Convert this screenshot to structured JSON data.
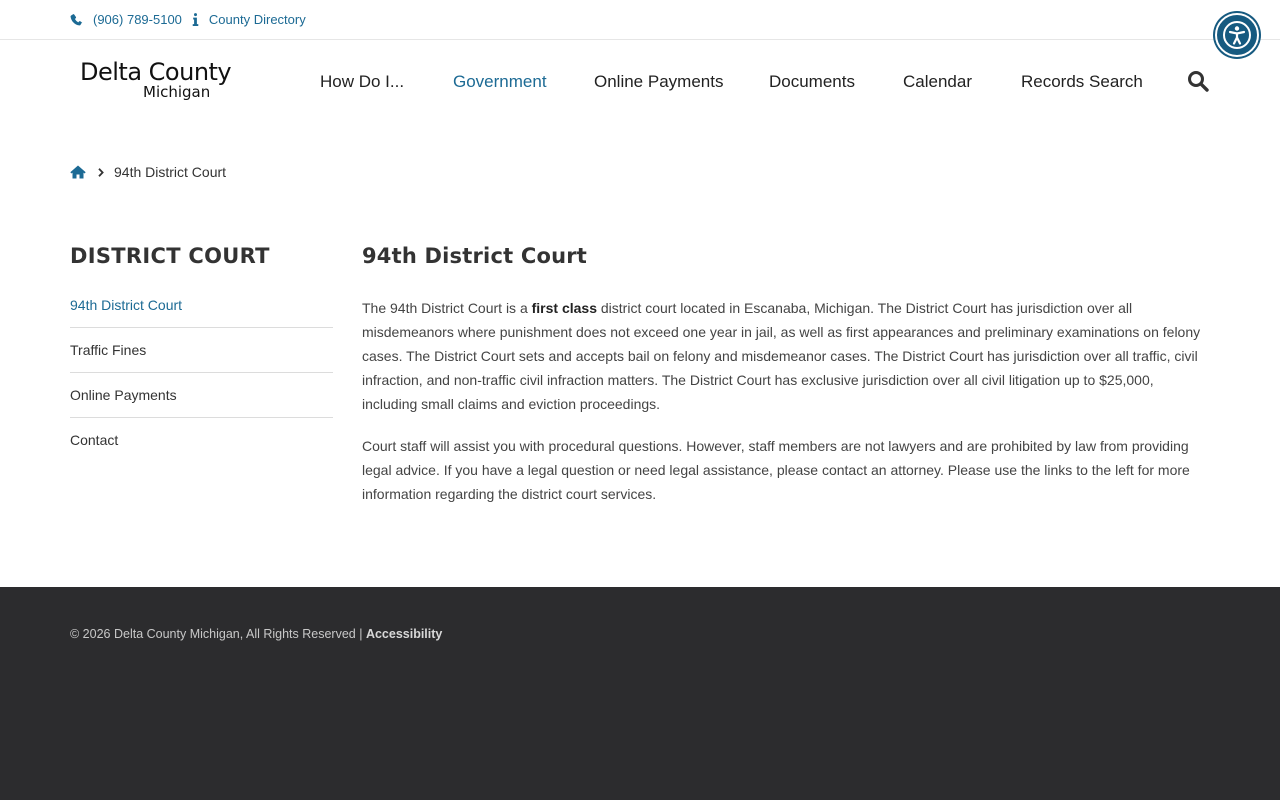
{
  "topbar": {
    "phone": "(906) 789-5100",
    "directory": "County Directory"
  },
  "logo": {
    "line1": "Delta County",
    "line2": "Michigan"
  },
  "nav": {
    "items": [
      {
        "label": "How Do I..."
      },
      {
        "label": "Government"
      },
      {
        "label": "Online Payments"
      },
      {
        "label": "Documents"
      },
      {
        "label": "Calendar"
      },
      {
        "label": "Records Search"
      }
    ]
  },
  "breadcrumb": {
    "current": "94th District Court"
  },
  "sidebar": {
    "title": "DISTRICT COURT",
    "items": [
      {
        "label": "94th District Court"
      },
      {
        "label": "Traffic Fines"
      },
      {
        "label": "Online Payments"
      },
      {
        "label": "Contact"
      }
    ]
  },
  "content": {
    "title": "94th District Court",
    "p1_before": "The 94th District Court is a ",
    "p1_bold": "first class",
    "p1_after": " district court located in Escanaba, Michigan. The District Court has jurisdiction over all misdemeanors where punishment does not exceed one year in jail, as well as first appearances and preliminary examinations on felony cases. The District Court sets and accepts bail on felony and misdemeanor cases. The District Court has jurisdiction over all traffic, civil infraction, and non-traffic civil infraction matters. The District Court has exclusive jurisdiction over all civil litigation up to $25,000, including small claims and eviction proceedings.",
    "p2": "Court staff will assist you with procedural questions. However, staff members are not lawyers and are prohibited by law from providing legal advice. If you have a legal question or need legal assistance, please contact an attorney. Please use the links to the left for more information regarding the district court services."
  },
  "footer": {
    "copyright": "© 2026 Delta County Michigan, All Rights Reserved | ",
    "accessibility": "Accessibility"
  },
  "colors": {
    "accent": "#1c6a94",
    "footer_bg": "#2c2c2e"
  }
}
